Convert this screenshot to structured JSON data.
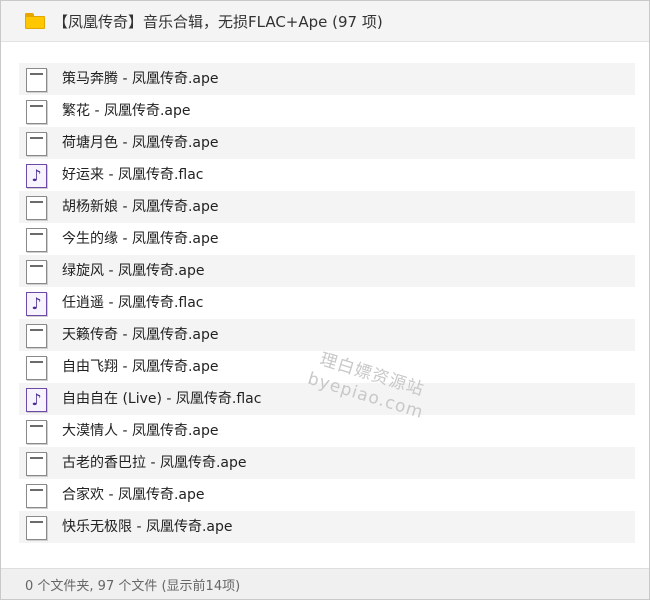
{
  "window": {
    "title": "【凤凰传奇】音乐合辑，无损FLAC+Ape (97 项)",
    "folder_icon": "folder-icon"
  },
  "files": [
    {
      "name": "策马奔腾 - 凤凰传奇.ape",
      "type": "ape"
    },
    {
      "name": "繁花 - 凤凰传奇.ape",
      "type": "ape"
    },
    {
      "name": "荷塘月色 - 凤凰传奇.ape",
      "type": "ape"
    },
    {
      "name": "好运来 - 凤凰传奇.flac",
      "type": "flac"
    },
    {
      "name": "胡杨新娘 - 凤凰传奇.ape",
      "type": "ape"
    },
    {
      "name": "今生的缘 - 凤凰传奇.ape",
      "type": "ape"
    },
    {
      "name": "绿旋风 - 凤凰传奇.ape",
      "type": "ape"
    },
    {
      "name": "任逍遥 - 凤凰传奇.flac",
      "type": "flac"
    },
    {
      "name": "天籁传奇 - 凤凰传奇.ape",
      "type": "ape"
    },
    {
      "name": "自由飞翔 - 凤凰传奇.ape",
      "type": "ape"
    },
    {
      "name": "自由自在 (Live) - 凤凰传奇.flac",
      "type": "flac"
    },
    {
      "name": "大漠情人 - 凤凰传奇.ape",
      "type": "ape"
    },
    {
      "name": "古老的香巴拉 - 凤凰传奇.ape",
      "type": "ape"
    },
    {
      "name": "合家欢 - 凤凰传奇.ape",
      "type": "ape"
    },
    {
      "name": "快乐无极限 - 凤凰传奇.ape",
      "type": "ape"
    }
  ],
  "watermark": {
    "line1": "理白嫖资源站",
    "line2": "byepiao.com"
  },
  "status": {
    "text": "0 个文件夹, 97 个文件 (显示前14项)"
  }
}
